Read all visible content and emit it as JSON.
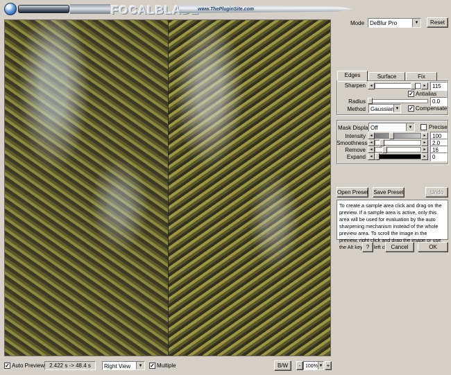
{
  "header": {
    "brand": "FOCALBLADE",
    "site": "www.ThePluginSite.com"
  },
  "mode": {
    "label": "Mode",
    "value": "DeBlur Pro",
    "reset": "Reset"
  },
  "tabs": [
    {
      "label": "Edges",
      "active": true
    },
    {
      "label": "Surface",
      "active": false
    },
    {
      "label": "Fix",
      "active": false
    }
  ],
  "edges": {
    "sharpen": {
      "label": "Sharpen",
      "value": "115",
      "level": 0.86
    },
    "antialias": {
      "label": "Antialias",
      "checked": true
    },
    "radius": {
      "label": "Radius",
      "value": "0.0",
      "level": 0.0
    },
    "method": {
      "label": "Method",
      "value": "Gaussian"
    },
    "compensate": {
      "label": "Compensate",
      "checked": true
    }
  },
  "mask": {
    "display": {
      "label": "Mask Display",
      "value": "Off"
    },
    "precise": {
      "label": "Precise",
      "checked": false
    },
    "intensity": {
      "label": "Intensity",
      "value": "100",
      "level": 0.35
    },
    "smoothness": {
      "label": "Smoothness",
      "value": "2.0",
      "level": 0.12
    },
    "remove": {
      "label": "Remove",
      "value": "16",
      "level": 0.18
    },
    "expand": {
      "label": "Expand",
      "value": "0",
      "level": 0.0
    }
  },
  "buttons": {
    "open_preset": "Open Preset",
    "save_preset": "Save Preset",
    "undo": "Undo",
    "help": "?",
    "cancel": "Cancel",
    "ok": "OK"
  },
  "info_text": "To create a sample area click and drag on the preview. If a sample area is active, only this area will be used for evaluation by the auto sharpening mechanism instead of the whole preview area. To scroll the image in the preview, right click and drag the image or use the Alt key and left click.",
  "bottom": {
    "auto_preview": {
      "label": "Auto Preview",
      "checked": true
    },
    "timing": "2.422 s -> 48.4 s",
    "view": "Right View",
    "multiple": {
      "label": "Multiple",
      "checked": true
    },
    "bw": "B/W",
    "zoom_minus": "-",
    "zoom": "100%",
    "zoom_plus": "+"
  },
  "colors": {
    "face": "#d4d0c8",
    "shadow": "#808080",
    "highlight": "#ffffff"
  }
}
